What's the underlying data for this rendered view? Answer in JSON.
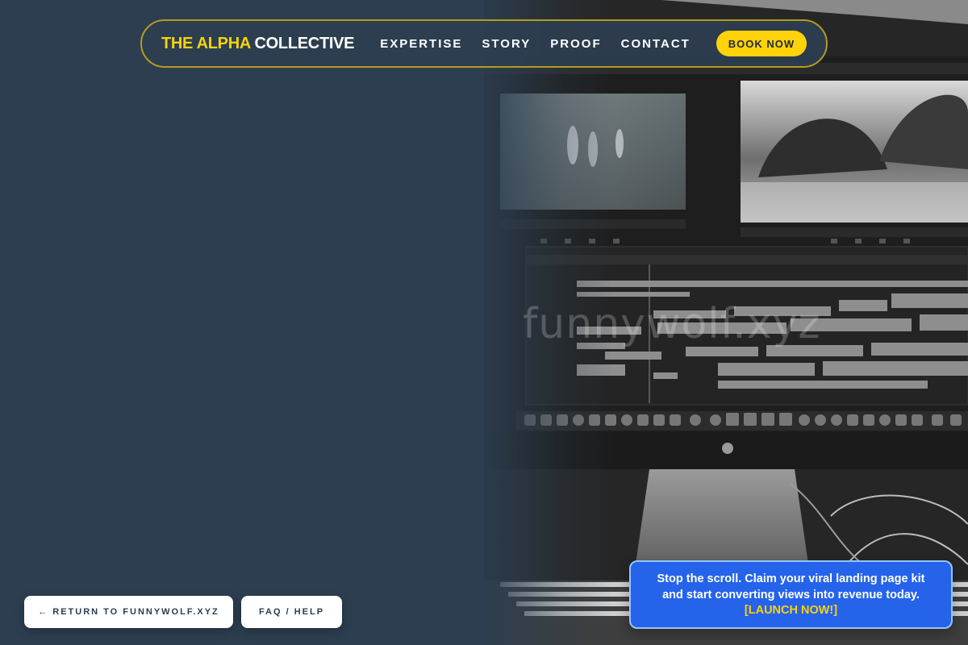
{
  "brand": {
    "accent": "THE ALPHA",
    "rest": "COLLECTIVE"
  },
  "nav": {
    "links": [
      "EXPERTISE",
      "STORY",
      "PROOF",
      "CONTACT"
    ],
    "cta_label": "BOOK NOW"
  },
  "watermark": "funnywolf.xyz",
  "footer_buttons": {
    "return_label": "← RETURN TO FUNNYWOLF.XYZ",
    "faq_label": "FAQ / HELP"
  },
  "cta_card": {
    "message": "Stop the scroll. Claim your viral landing page kit and start converting views into revenue today.",
    "link_label": "[LAUNCH NOW!]"
  },
  "colors": {
    "background": "#2c3e50",
    "accent_yellow": "#ffd20a",
    "cta_blue": "#2563eb"
  }
}
